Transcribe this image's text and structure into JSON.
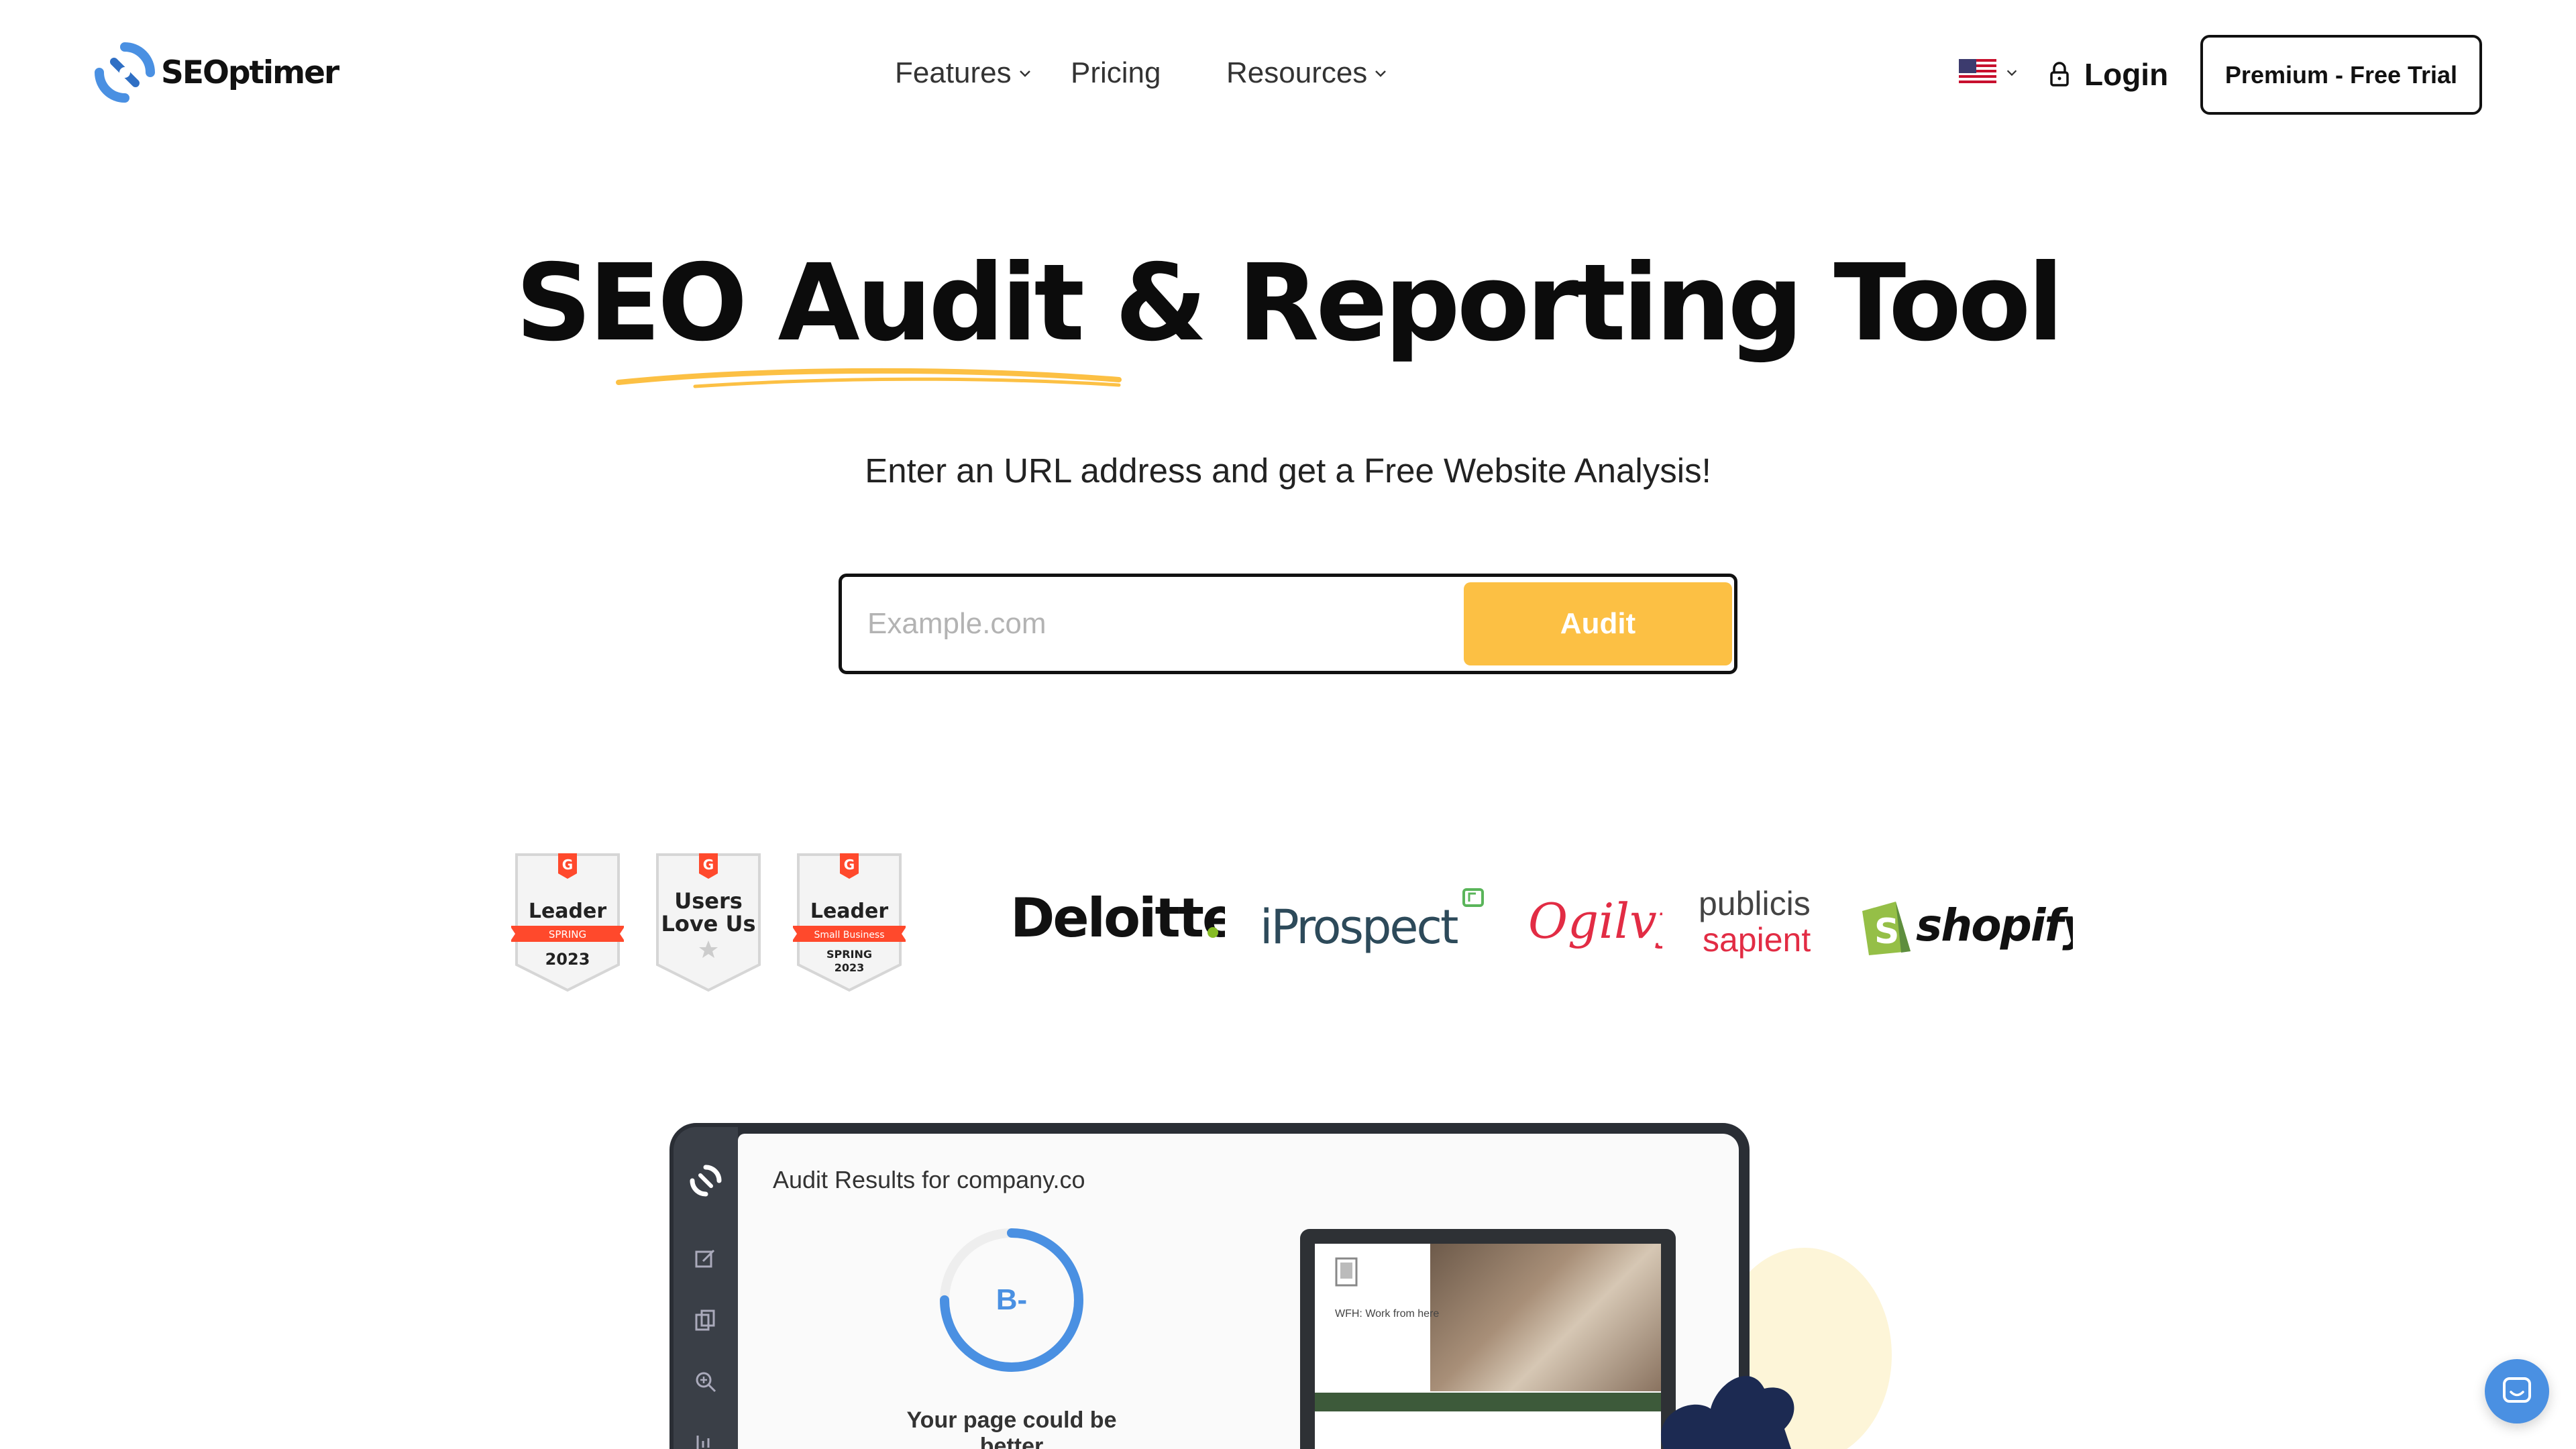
{
  "header": {
    "logo_text": "SEOptimer",
    "nav": [
      {
        "label": "Features",
        "has_dropdown": true
      },
      {
        "label": "Pricing",
        "has_dropdown": false
      },
      {
        "label": "Resources",
        "has_dropdown": true
      }
    ],
    "login_label": "Login",
    "trial_label": "Premium - Free Trial",
    "language_icon": "us-flag-icon"
  },
  "hero": {
    "title": "SEO Audit & Reporting Tool",
    "subtitle": "Enter an URL address and get a Free Website Analysis!",
    "search_placeholder": "Example.com",
    "search_value": "",
    "audit_label": "Audit",
    "accent_color": "#fcc044"
  },
  "badges": [
    {
      "title": "Leader",
      "ribbon": "SPRING",
      "year": "2023",
      "stacked": false
    },
    {
      "title_line1": "Users",
      "title_line2": "Love Us"
    },
    {
      "title": "Leader",
      "ribbon": "Small Business",
      "season": "SPRING",
      "year": "2023"
    }
  ],
  "clients": [
    "Deloitte",
    "iProspect",
    "Ogilvy",
    "publicis",
    "sapient",
    "shopify"
  ],
  "preview": {
    "audit_title": "Audit Results for company.co",
    "grade": "B-",
    "grade_fraction": 0.75,
    "grade_message": "Your page could be better",
    "mini_caption": "WFH: Work from here"
  }
}
